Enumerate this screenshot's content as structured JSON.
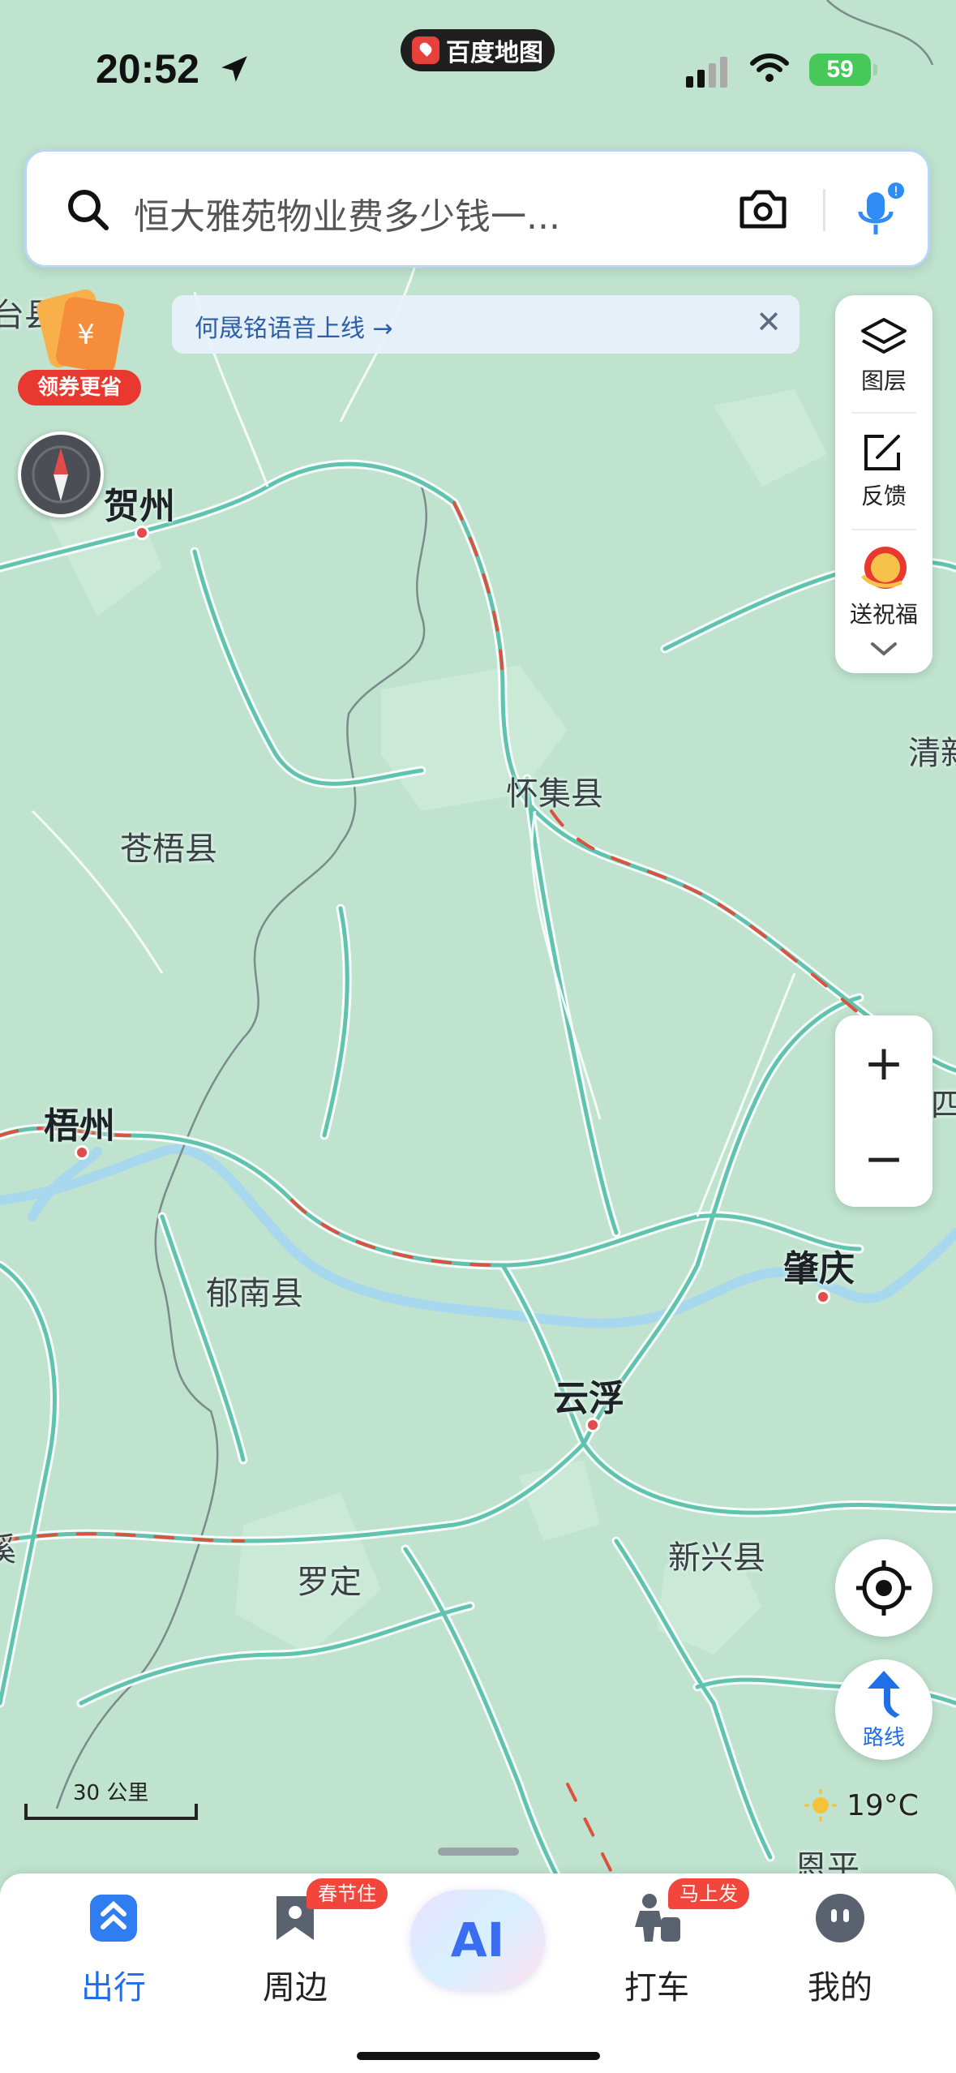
{
  "status_bar": {
    "time": "20:52",
    "app_name": "百度地图",
    "battery": "59"
  },
  "search": {
    "placeholder": "恒大雅苑物业费多少钱一..."
  },
  "notice": {
    "text": "何晟铭语音上线 →",
    "close": "✕"
  },
  "coupon": {
    "label": "领券更省"
  },
  "right_panel": {
    "layers": "图层",
    "feedback": "反馈",
    "blessing": "送祝福"
  },
  "zoom": {
    "in": "+",
    "out": "−"
  },
  "route": {
    "label": "路线"
  },
  "weather": {
    "temp": "19°C"
  },
  "scale": {
    "label": "30 公里"
  },
  "map": {
    "labels": {
      "hezhou": "贺州",
      "huaiji": "怀集县",
      "cangwu": "苍梧县",
      "wuzhou": "梧州",
      "yunan": "郁南县",
      "zhaoqing": "肇庆",
      "yunfu": "云浮",
      "luoding": "罗定",
      "xinxing": "新兴县",
      "qing_partial": "清新",
      "en_partial": "恩平",
      "xi_partial": "溪",
      "tai_partial": "台县",
      "si_partial": "四会"
    }
  },
  "bottom_nav": {
    "items": [
      {
        "label": "出行",
        "active": true
      },
      {
        "label": "周边",
        "badge": "春节住"
      },
      {
        "label": "AI"
      },
      {
        "label": "打车",
        "badge": "马上发"
      },
      {
        "label": "我的"
      }
    ]
  },
  "colors": {
    "accent": "#1f6fe8",
    "map_bg": "#bfe3cf",
    "road": "#6cc7b0",
    "badge": "#f2453c"
  }
}
